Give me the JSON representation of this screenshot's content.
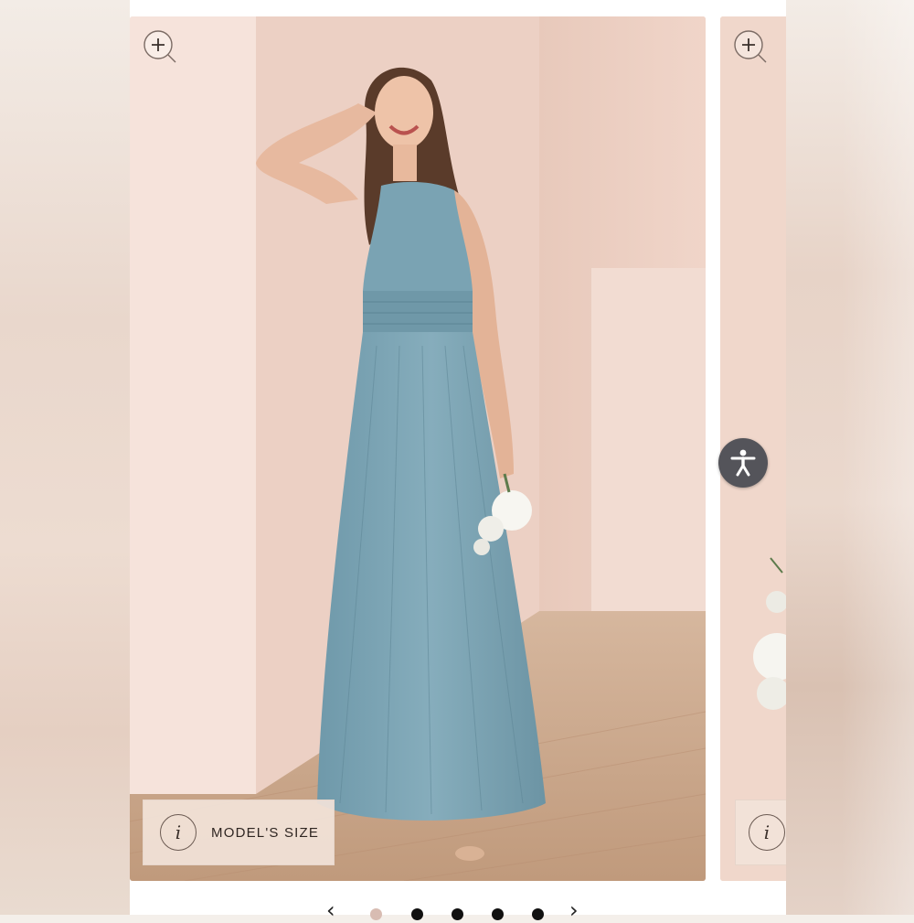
{
  "gallery": {
    "model_size_button": {
      "label": "MODEL'S SIZE",
      "icon": "info-icon",
      "glyph": "i"
    },
    "next_info_button": {
      "icon": "info-icon",
      "glyph": "i"
    },
    "zoom_icon": "zoom-in-icon",
    "accessibility_icon": "accessibility-icon",
    "pager": {
      "prev_glyph": "‹",
      "next_glyph": "›",
      "dots": [
        {
          "active": true
        },
        {
          "active": false
        },
        {
          "active": false
        },
        {
          "active": false
        },
        {
          "active": false
        }
      ]
    }
  },
  "colors": {
    "wall": "#f1d9ce",
    "dress": "#7ba3b3",
    "floor": "#c9a588",
    "accessibility_bg": "#54545a",
    "active_dot": "#d8bcb2"
  }
}
